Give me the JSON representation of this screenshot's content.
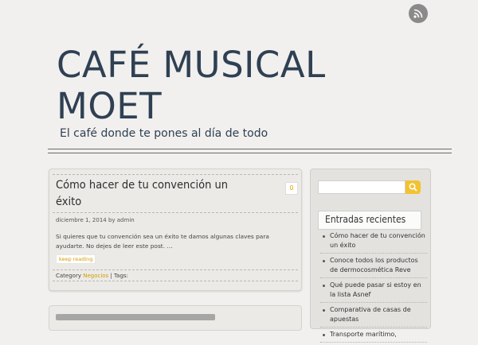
{
  "site": {
    "title": "CAFÉ MUSICAL MOET",
    "tagline": "El café donde te pones al día de todo"
  },
  "header": {
    "rss_icon": "rss-icon"
  },
  "post": {
    "title": "Cómo hacer de tu convención un éxito",
    "comments": "0",
    "meta": "diciembre 1, 2014 by admin",
    "excerpt": "Si quieres que tu convención sea un éxito te damos algunas claves para ayudarte. No dejes de leer este post. …",
    "keep_reading": "keep reading",
    "category_label": "Category",
    "category": "Negocios",
    "tags_label": "| Tags:"
  },
  "sidebar": {
    "search": {
      "placeholder": "",
      "icon": "search-icon"
    },
    "widget_title": "Entradas recientes",
    "recent": [
      "Cómo hacer de tu convención un éxito",
      "Conoce todos los productos de dermocosmética Reve",
      "Qué puede pasar si estoy en la lista Asnef",
      "Comparativa de casas de apuestas",
      "Transporte marítimo,"
    ]
  },
  "colors": {
    "background": "#f1f0ee",
    "title": "#2f4053",
    "accent": "#f2c230",
    "link": "#d39e00"
  }
}
